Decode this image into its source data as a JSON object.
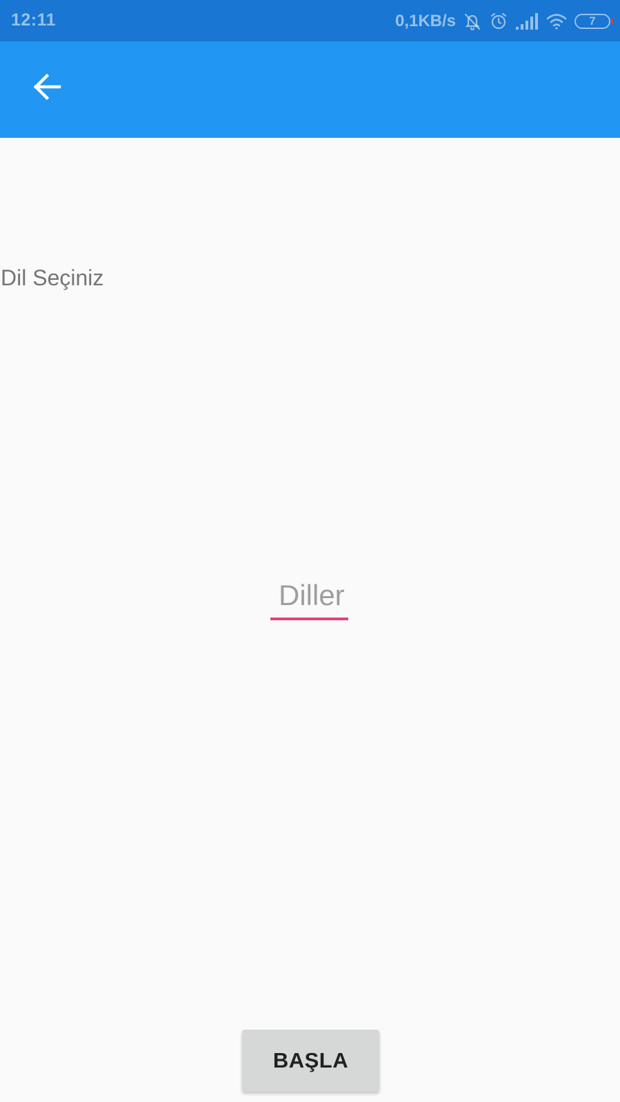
{
  "status_bar": {
    "time": "12:11",
    "network_speed": "0,1KB/s",
    "battery_level": "7",
    "icons": [
      "bell-off-icon",
      "alarm-icon",
      "signal-icon",
      "wifi-icon",
      "battery-icon"
    ]
  },
  "app_bar": {
    "color": "#2196f3",
    "back_icon": "arrow-left-icon"
  },
  "main": {
    "prompt_label": "Dil Seçiniz",
    "dropdown": {
      "hint": "Diller",
      "underline_color": "#ec407a"
    },
    "start_button_label": "BAŞLA"
  }
}
